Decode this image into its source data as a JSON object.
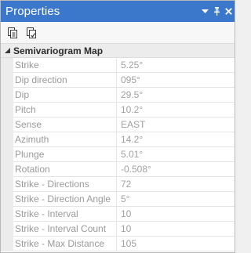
{
  "window": {
    "title": "Properties"
  },
  "section": {
    "title": "Semivariogram Map"
  },
  "properties": [
    {
      "name": "Strike",
      "value": "5.25°"
    },
    {
      "name": "Dip direction",
      "value": "095°"
    },
    {
      "name": "Dip",
      "value": "29.5°"
    },
    {
      "name": "Pitch",
      "value": "10.2°"
    },
    {
      "name": "Sense",
      "value": "EAST"
    },
    {
      "name": "Azimuth",
      "value": "14.2°"
    },
    {
      "name": "Plunge",
      "value": "5.01°"
    },
    {
      "name": "Rotation",
      "value": "-0.508°"
    },
    {
      "name": "Strike - Directions",
      "value": "72"
    },
    {
      "name": "Strike - Direction Angle",
      "value": "5°"
    },
    {
      "name": "Strike - Interval",
      "value": "10"
    },
    {
      "name": "Strike - Interval Count",
      "value": "10"
    },
    {
      "name": "Strike - Max Distance",
      "value": "105"
    }
  ],
  "colors": {
    "titlebar": "#3b78cc",
    "label_text": "#9a9a9a",
    "value_text": "#a0a0a0"
  }
}
